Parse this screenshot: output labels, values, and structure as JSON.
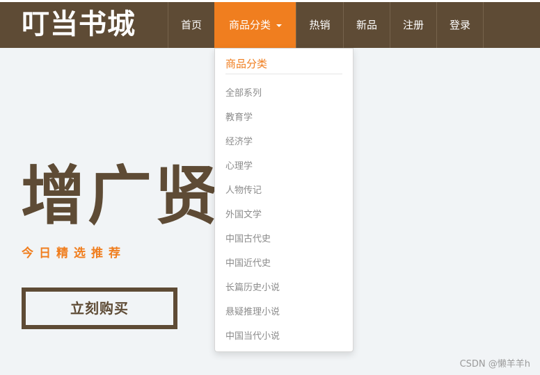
{
  "brand": "叮当书城",
  "nav": {
    "home": "首页",
    "categories": "商品分类",
    "hot": "热销",
    "new": "新品",
    "register": "注册",
    "login": "登录"
  },
  "dropdown": {
    "header": "商品分类",
    "items": [
      "全部系列",
      "教育学",
      "经济学",
      "心理学",
      "人物传记",
      "外国文学",
      "中国古代史",
      "中国近代史",
      "长篇历史小说",
      "悬疑推理小说",
      "中国当代小说"
    ]
  },
  "hero": {
    "title": "增广贤文",
    "subtitle": "今日精选推荐",
    "button": "立刻购买"
  },
  "watermark": "CSDN @懒羊羊h",
  "colors": {
    "brown": "#5e4b35",
    "orange": "#f07e1f",
    "background": "#f1f4f6"
  }
}
